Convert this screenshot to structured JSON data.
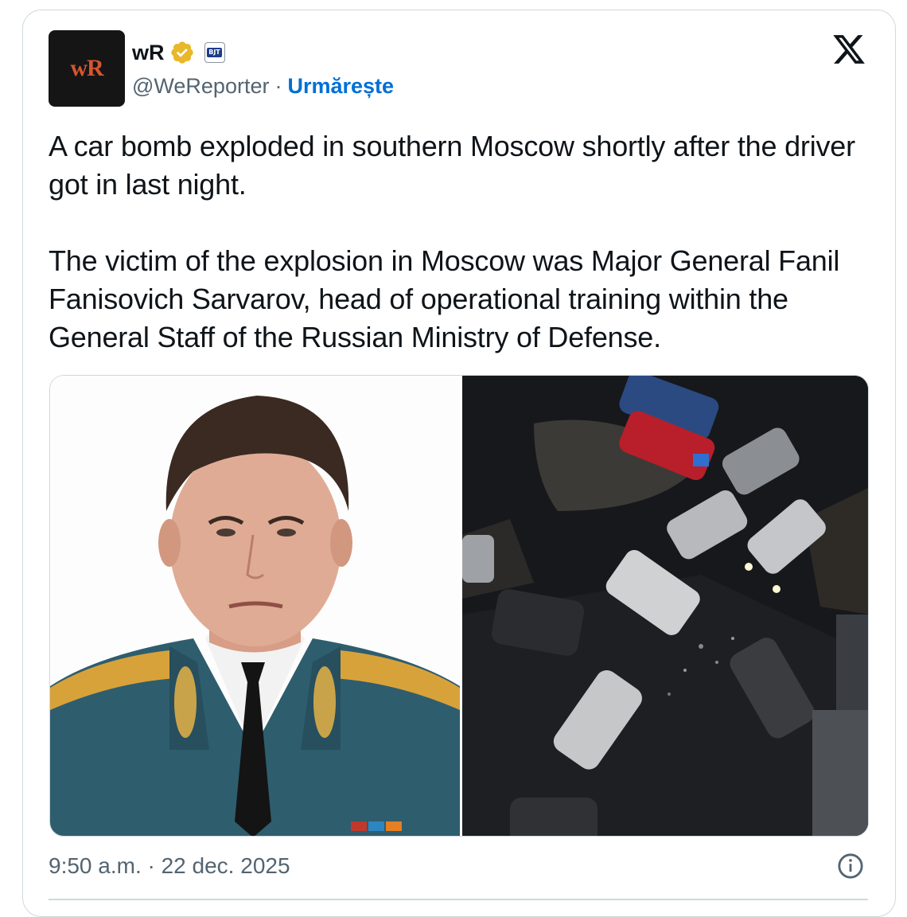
{
  "author": {
    "avatar_text": "wR",
    "name": "wR",
    "handle": "@WeReporter",
    "separator": "·",
    "follow_label": "Urmărește",
    "verified_icon": "verified-badge-icon",
    "affiliate_badge_text": "BJT"
  },
  "tweet": {
    "text": "A car bomb exploded in southern Moscow shortly after the driver got in last night.\n\nThe victim of the explosion in Moscow was Major General Fanil Fanisovich Sarvarov, head of operational training within the General Staff of the Russian Ministry of Defense."
  },
  "media": {
    "images": [
      "portrait-photo",
      "explosion-scene-photo"
    ]
  },
  "footer": {
    "timestamp": "9:50 a.m. · 22 dec. 2025",
    "info_icon": "info-icon"
  },
  "colors": {
    "accent": "#006fd6",
    "muted_text": "#536471",
    "border": "#cfd9de",
    "verified_gold": "#e8b829"
  }
}
